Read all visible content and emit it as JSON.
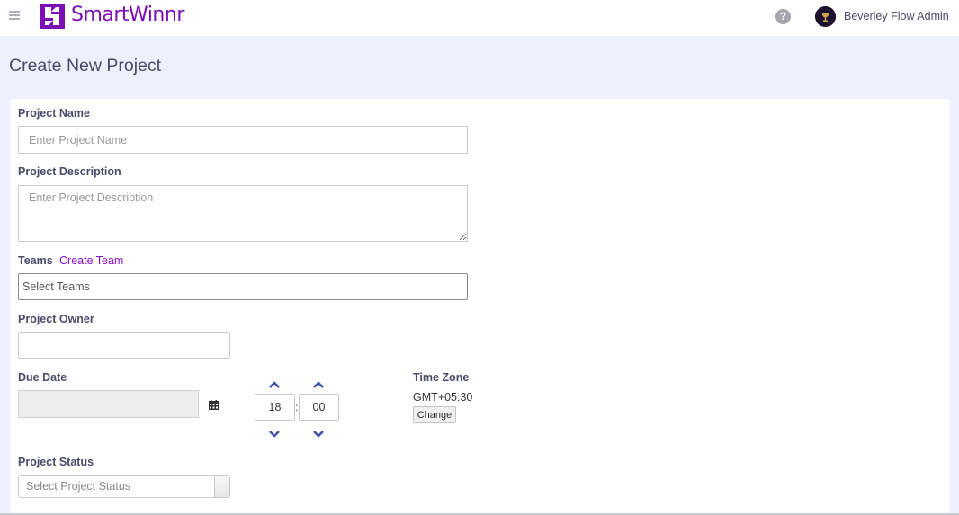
{
  "header": {
    "logo_text": "SmartWinnr",
    "user_name": "Beverley Flow Admin",
    "help_glyph": "?",
    "brand_color": "#7b0fb3"
  },
  "page": {
    "title": "Create New Project"
  },
  "form": {
    "project_name": {
      "label": "Project Name",
      "placeholder": "Enter Project Name",
      "value": ""
    },
    "project_description": {
      "label": "Project Description",
      "placeholder": "Enter Project Description",
      "value": ""
    },
    "teams": {
      "label": "Teams",
      "create_link": "Create Team",
      "select_text": "Select Teams"
    },
    "project_owner": {
      "label": "Project Owner",
      "value": ""
    },
    "due_date": {
      "label": "Due Date",
      "value": "",
      "calendar_icon": "calendar-icon"
    },
    "time": {
      "hour": "18",
      "minute": "00",
      "separator": ":"
    },
    "time_zone": {
      "label": "Time Zone",
      "value": "GMT+05:30",
      "change_label": "Change"
    },
    "project_status": {
      "label": "Project Status",
      "placeholder": "Select Project Status"
    }
  }
}
